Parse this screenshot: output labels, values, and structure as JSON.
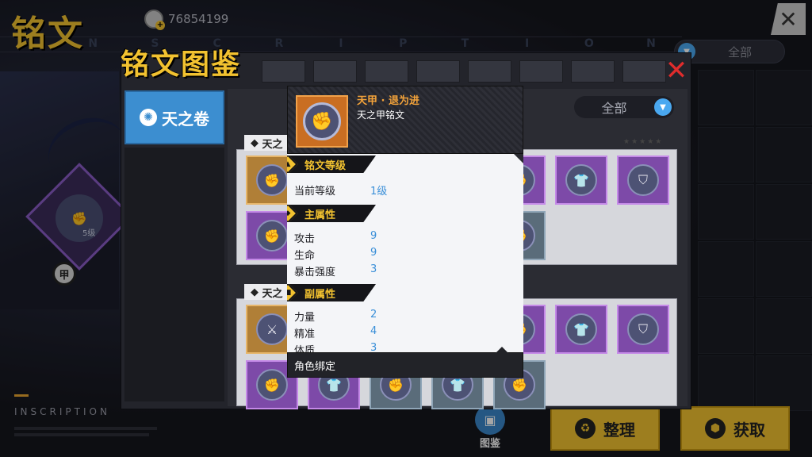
{
  "background": {
    "title": "铭文",
    "currency": "76854199",
    "filter_label": "全部",
    "tab_letters": [
      "I",
      "N",
      "S",
      "C",
      "R",
      "I",
      "P",
      "T",
      "I",
      "O",
      "N"
    ],
    "inscription_label": "INSCRIPTION",
    "side_item_level": "5级",
    "side_item_badge": "甲"
  },
  "panel": {
    "title": "铭文图鉴",
    "tab_label": "天之卷",
    "filter_label": "全部",
    "group1_label": "天之",
    "group2_label": "天之",
    "group_stars": "★★★★★"
  },
  "popup": {
    "name": "天甲 · 退为进",
    "subtitle": "天之甲铭文",
    "sections": {
      "level": {
        "title": "铭文等级",
        "rows": [
          {
            "label": "当前等级",
            "value": "1级"
          }
        ]
      },
      "main": {
        "title": "主属性",
        "rows": [
          {
            "label": "攻击",
            "value": "9"
          },
          {
            "label": "生命",
            "value": "9"
          },
          {
            "label": "暴击强度",
            "value": "3"
          }
        ]
      },
      "sub": {
        "title": "副属性",
        "rows": [
          {
            "label": "力量",
            "value": "2"
          },
          {
            "label": "精准",
            "value": "4"
          },
          {
            "label": "体质",
            "value": "3"
          }
        ]
      }
    },
    "footer": "角色绑定"
  },
  "bottom": {
    "tujian_label": "图鉴",
    "organize_label": "整理",
    "obtain_label": "获取"
  },
  "colors": {
    "accent_yellow": "#f2c230",
    "accent_blue": "#3c8ed0",
    "value_blue": "#3a8fd8",
    "name_orange": "#f2a23a",
    "close_red": "#e02c2c"
  },
  "icons": {
    "currency": "coin-icon",
    "close": "close-icon",
    "tab": "sun-icon",
    "filter": "dropdown-icon",
    "inscription": "fist-icon",
    "organize": "recycle-icon",
    "obtain": "hexagon-icon",
    "tujian": "codex-icon"
  }
}
